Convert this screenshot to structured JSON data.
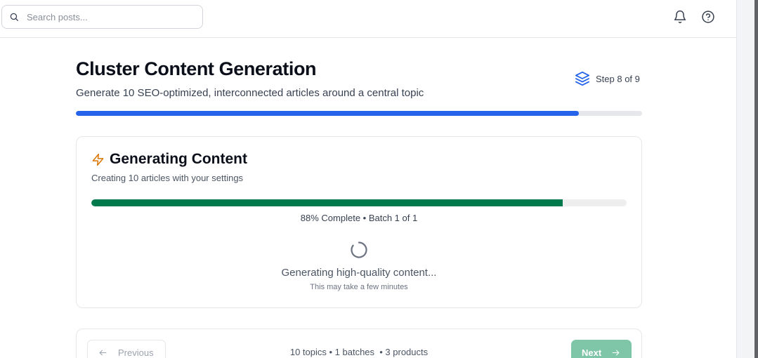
{
  "header": {
    "search_placeholder": "Search posts...",
    "icons": [
      "search-icon",
      "bell-icon",
      "help-circle-icon"
    ]
  },
  "page": {
    "title": "Cluster Content Generation",
    "subtitle": "Generate 10 SEO-optimized, interconnected articles around a central topic",
    "step_label": "Step 8 of 9",
    "step_icon": "layers-icon",
    "overall_progress": 0.888,
    "accent_color": "#2563eb"
  },
  "generation_card": {
    "title": "Generating Content",
    "title_icon": "lightning-icon",
    "subtitle": "Creating 10 articles with your settings",
    "progress": 0.88,
    "progress_color": "#007a4d",
    "status_text": "88% Complete • Batch 1 of 1",
    "message": "Generating high-quality content...",
    "hint": "This may take a few minutes"
  },
  "navigation": {
    "previous_label": "Previous",
    "summary": "10 topics • 1 batches  • 3 products",
    "next_label": "Next",
    "next_color": "#7fc5a8"
  }
}
